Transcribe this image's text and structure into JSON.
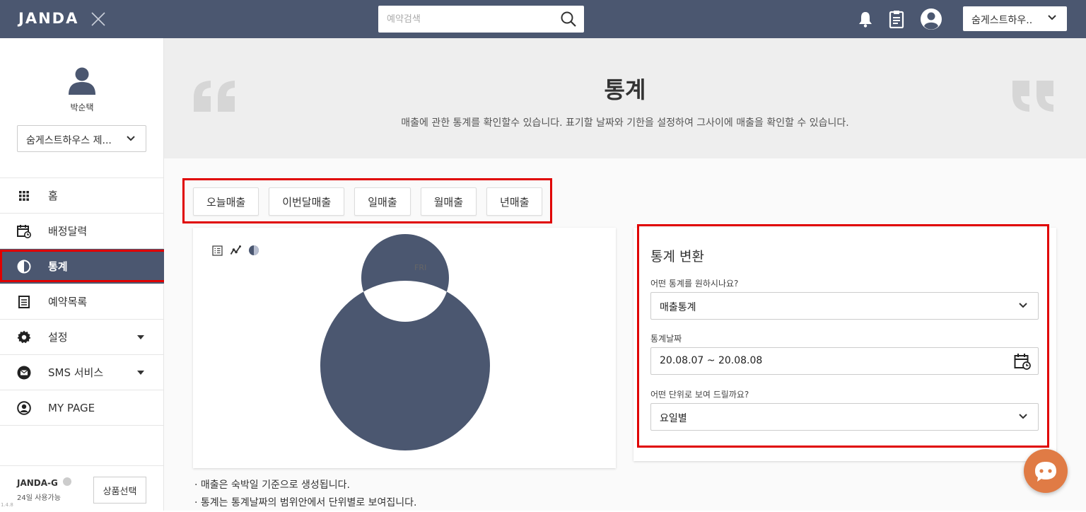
{
  "topbar": {
    "logo": "JANDA",
    "search_placeholder": "예약검색",
    "store_select": "숨게스트하우.."
  },
  "sidebar": {
    "username": "박순택",
    "store_select": "숨게스트하우스 제...",
    "items": [
      {
        "label": "홈"
      },
      {
        "label": "배정달력"
      },
      {
        "label": "통계"
      },
      {
        "label": "예약목록"
      },
      {
        "label": "설정"
      },
      {
        "label": "SMS 서비스"
      },
      {
        "label": "MY PAGE"
      }
    ],
    "plan_name": "JANDA-G",
    "plan_days": "24일 사용가능",
    "plan_button": "상품선택",
    "version": "1.4.8"
  },
  "hero": {
    "title": "통계",
    "description": "매출에 관한 통계를 확인할수 있습니다. 표기할 날짜와 기한을 설정하여 그사이에 매출을 확인할 수 있습니다."
  },
  "tabs": [
    "오늘매출",
    "이번달매출",
    "일매출",
    "월매출",
    "년매출"
  ],
  "chart_data": {
    "type": "pie",
    "donut": true,
    "categories": [
      "FRI"
    ],
    "values": [
      100
    ],
    "legend": [
      "FRI"
    ],
    "legend_position": "top",
    "colors": [
      "#4b5770"
    ]
  },
  "notes": [
    "· 매출은 숙박일 기준으로 생성됩니다.",
    "· 통계는 통계날짜의 범위안에서 단위별로 보여집니다."
  ],
  "form": {
    "title": "통계 변환",
    "q1_label": "어떤 통계를 원하시나요?",
    "q1_value": "매출통계",
    "date_label": "통계날짜",
    "date_value": "20.08.07 ~ 20.08.08",
    "q2_label": "어떤 단위로 보여 드릴까요?",
    "q2_value": "요일별"
  },
  "colors": {
    "topbar": "#4b5770",
    "highlight": "#e00000",
    "chat": "#e07b45"
  }
}
